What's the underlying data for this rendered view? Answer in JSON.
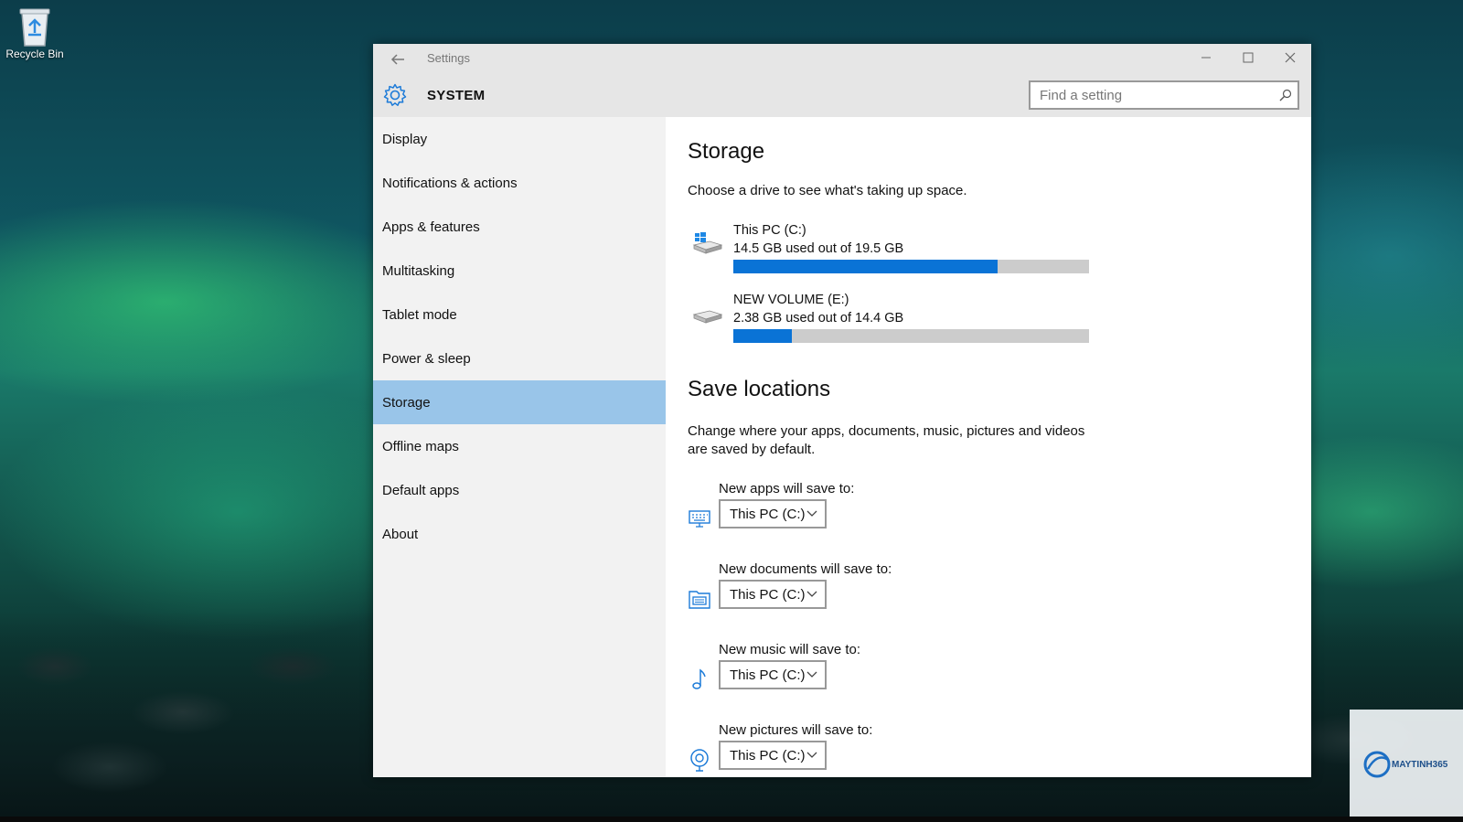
{
  "desktop": {
    "recycle_bin_label": "Recycle Bin"
  },
  "window": {
    "app_title": "Settings",
    "section_title": "SYSTEM",
    "search_placeholder": "Find a setting"
  },
  "sidebar": {
    "items": [
      {
        "label": "Display"
      },
      {
        "label": "Notifications & actions"
      },
      {
        "label": "Apps & features"
      },
      {
        "label": "Multitasking"
      },
      {
        "label": "Tablet mode"
      },
      {
        "label": "Power & sleep"
      },
      {
        "label": "Storage",
        "selected": true
      },
      {
        "label": "Offline maps"
      },
      {
        "label": "Default apps"
      },
      {
        "label": "About"
      }
    ]
  },
  "storage": {
    "title": "Storage",
    "description": "Choose a drive to see what's taking up space.",
    "drives": [
      {
        "name": "This PC (C:)",
        "usage": "14.5 GB used out of 19.5 GB",
        "used_fraction": 0.744
      },
      {
        "name": "NEW VOLUME (E:)",
        "usage": "2.38 GB used out of 14.4 GB",
        "used_fraction": 0.165
      }
    ]
  },
  "save_locations": {
    "title": "Save locations",
    "description": "Change where your apps, documents, music, pictures and videos are saved by default.",
    "items": [
      {
        "label": "New apps will save to:",
        "value": "This PC (C:)",
        "icon": "apps-icon"
      },
      {
        "label": "New documents will save to:",
        "value": "This PC (C:)",
        "icon": "documents-icon"
      },
      {
        "label": "New music will save to:",
        "value": "This PC (C:)",
        "icon": "music-icon"
      },
      {
        "label": "New pictures will save to:",
        "value": "This PC (C:)",
        "icon": "pictures-icon"
      }
    ]
  },
  "watermark": {
    "text": "MAYTINH365"
  },
  "colors": {
    "accent": "#0a73d6",
    "selected_nav": "#99c5e9",
    "bar_track": "#cccccc"
  }
}
